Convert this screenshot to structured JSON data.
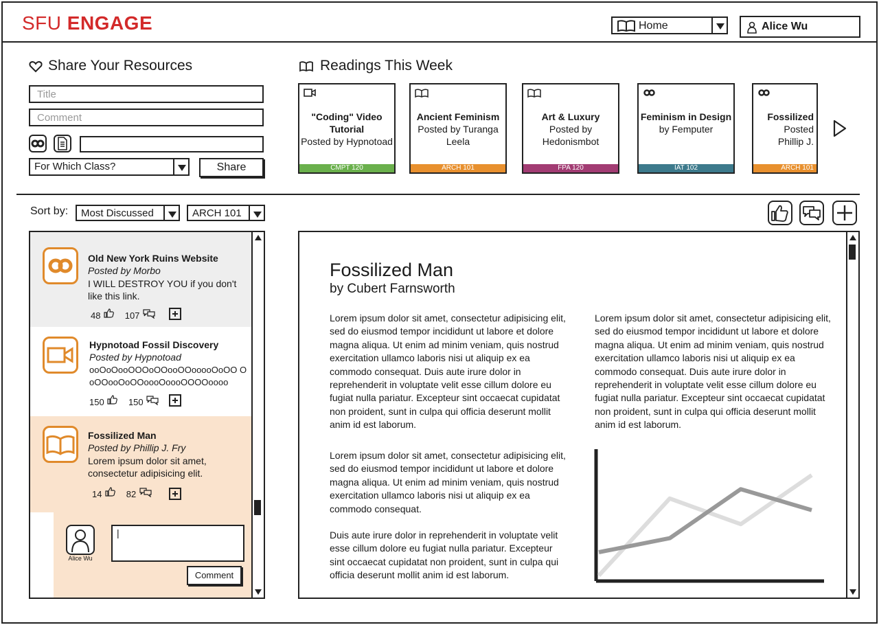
{
  "header": {
    "brand_light": "SFU",
    "brand_bold": "ENGAGE",
    "nav_select": "Home",
    "user": "Alice Wu"
  },
  "share": {
    "title": "Share Your Resources",
    "title_placeholder": "Title",
    "comment_placeholder": "Comment",
    "class_select": "For Which Class?",
    "share_button": "Share"
  },
  "readings": {
    "title": "Readings This Week",
    "cards": [
      {
        "icon": "video-icon",
        "title_1": "\"Coding\" Video",
        "title_2": "Tutorial",
        "posted_1": "Posted by Hypnotoad",
        "posted_2": "",
        "tag": "CMPT 120",
        "color": "#6ab04c"
      },
      {
        "icon": "book-icon",
        "title_1": "Ancient Feminism",
        "title_2": "",
        "posted_1": "Posted by Turanga",
        "posted_2": "Leela",
        "tag": "ARCH 101",
        "color": "#e8902e"
      },
      {
        "icon": "book-icon",
        "title_1": "Art & Luxury",
        "title_2": "",
        "posted_1": "Posted by",
        "posted_2": "Hedonismbot",
        "tag": "FPA 120",
        "color": "#a23c73"
      },
      {
        "icon": "link-icon",
        "title_1": "Feminism in Design",
        "title_2": "",
        "posted_1": "by Femputer",
        "posted_2": "",
        "tag": "IAT 102",
        "color": "#3d7a8c"
      },
      {
        "icon": "link-icon",
        "title_1": "Fossilized",
        "title_2": "",
        "posted_1": "Posted",
        "posted_2": "Phillip J.",
        "tag": "ARCH 101",
        "color": "#e8902e"
      }
    ]
  },
  "sort": {
    "label": "Sort by:",
    "order": "Most Discussed",
    "course": "ARCH 101"
  },
  "list": {
    "items": [
      {
        "title": "Old New York Ruins Website",
        "posted": "Posted by Morbo",
        "desc": "I WILL DESTROY YOU if you don't like this link.",
        "likes": "48",
        "comments": "107"
      },
      {
        "title": "Hypnotoad Fossil Discovery",
        "posted": "Posted by Hypnotoad",
        "desc": "ooOoOooOOOoOOooOOooooOoOO OoOOooOoOOoooOoooOOOOoooo",
        "likes": "150",
        "comments": "150"
      },
      {
        "title": "Fossilized Man",
        "posted": "Posted by Phillip J. Fry",
        "desc": "Lorem ipsum dolor sit amet, consectetur adipisicing elit.",
        "likes": "14",
        "comments": "82"
      }
    ],
    "reply": {
      "avatar_name": "Alice Wu",
      "value": "|",
      "button": "Comment"
    }
  },
  "article": {
    "title": "Fossilized Man",
    "byline": "by Cubert Farnsworth",
    "p1": "Lorem ipsum dolor sit amet, consectetur adipisicing elit, sed do eiusmod tempor incididunt ut labore et dolore magna aliqua. Ut enim ad minim veniam, quis nostrud exercitation ullamco laboris nisi ut aliquip ex ea commodo consequat. Duis aute irure dolor in reprehenderit in voluptate velit esse cillum dolore eu fugiat nulla pariatur. Excepteur sint occaecat cupidatat non proident, sunt in culpa qui officia deserunt mollit anim id est laborum.",
    "p2": "Lorem ipsum dolor sit amet, consectetur adipisicing elit, sed do eiusmod tempor incididunt ut labore et dolore magna aliqua. Ut enim ad minim veniam, quis nostrud exercitation ullamco laboris nisi ut aliquip ex ea commodo consequat.",
    "p3": "Duis aute irure dolor in reprehenderit in voluptate velit esse cillum dolore eu fugiat nulla pariatur. Excepteur sint occaecat cupidatat non proident, sunt in culpa qui officia deserunt mollit anim id est laborum.",
    "p4": "Lorem ipsum dolor sit amet, consectetur adipisicing elit, sed do eiusmod tempor incididunt ut labore et dolore magna aliqua. Ut enim ad minim veniam, quis nostrud exercitation ullamco laboris nisi ut aliquip ex ea commodo consequat. Duis aute irure dolor in reprehenderit in voluptate velit esse cillum dolore eu fugiat nulla pariatur. Excepteur sint occaecat cupidatat non proident, sunt in culpa qui officia deserunt mollit anim id est laborum."
  },
  "chart_data": {
    "type": "line",
    "x": [
      0,
      1,
      2,
      3
    ],
    "series": [
      {
        "values": [
          1.0,
          1.6,
          3.7,
          2.8
        ],
        "color": "#999999"
      },
      {
        "values": [
          0.0,
          3.3,
          2.2,
          4.3
        ],
        "color": "#dddddd"
      }
    ],
    "ylim": [
      0,
      5
    ],
    "title": "",
    "xlabel": "",
    "ylabel": "",
    "grid": false
  },
  "colors": {
    "brand": "#d32a2a",
    "accent_orange": "#e08a2b",
    "highlight": "#fae3cd",
    "muted": "#eeeeee"
  }
}
